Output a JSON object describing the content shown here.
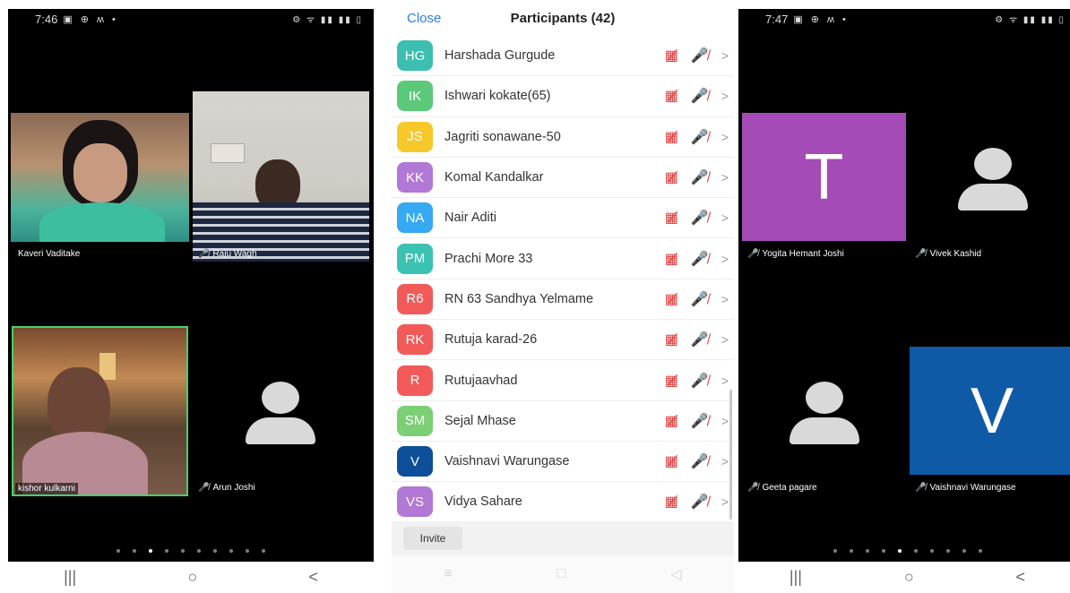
{
  "left_phone": {
    "status_time": "7:46",
    "status_icons": "▣ ⊕ ʍ •",
    "status_right": "⚙ ᯤ ▮▮ ▮▮ ▯",
    "tiles": [
      {
        "name": "Kaveri Vaditake",
        "muted": false
      },
      {
        "name": "Raju Wagh",
        "muted": true
      },
      {
        "name": "kishor kulkarni",
        "muted": false
      },
      {
        "name": "Arun Joshi",
        "muted": true
      }
    ],
    "nav": [
      "|||",
      "○",
      "<"
    ]
  },
  "participants": {
    "close_label": "Close",
    "title": "Participants (42)",
    "rows": [
      {
        "initials": "HG",
        "name": "Harshada Gurgude",
        "color": "#3cbfb0"
      },
      {
        "initials": "IK",
        "name": "Ishwari kokate(65)",
        "color": "#5cc97a"
      },
      {
        "initials": "JS",
        "name": "Jagriti sonawane-50",
        "color": "#f7c82a"
      },
      {
        "initials": "KK",
        "name": "Komal Kandalkar",
        "color": "#b178d6"
      },
      {
        "initials": "NA",
        "name": "Nair Aditi",
        "color": "#35a9f2"
      },
      {
        "initials": "PM",
        "name": "Prachi More 33",
        "color": "#3cc2b3"
      },
      {
        "initials": "R6",
        "name": "RN 63 Sandhya Yelmame",
        "color": "#f25a5a"
      },
      {
        "initials": "RK",
        "name": "Rutuja karad-26",
        "color": "#f25a5a"
      },
      {
        "initials": "R",
        "name": "Rutujaavhad",
        "color": "#f25a5a"
      },
      {
        "initials": "SM",
        "name": "Sejal Mhase",
        "color": "#7ccf74"
      },
      {
        "initials": "V",
        "name": "Vaishnavi Warungase",
        "color": "#0e4f9a"
      },
      {
        "initials": "VS",
        "name": "Vidya Sahare",
        "color": "#b178d6"
      }
    ],
    "invite_label": "Invite",
    "nav": [
      "≡",
      "□",
      "◁"
    ]
  },
  "right_phone": {
    "status_time": "7:47",
    "status_icons": "▣ ⊕ ʍ •",
    "status_right": "⚙ ᯤ ▮▮ ▮▮ ▯",
    "tiles": [
      {
        "letter": "T",
        "name": "Yogita Hemant Joshi",
        "color": "#a44bb8"
      },
      {
        "letter": "",
        "name": "Vivek Kashid",
        "color": "#000000"
      },
      {
        "letter": "",
        "name": "Geeta pagare",
        "color": "#000000"
      },
      {
        "letter": "V",
        "name": "Vaishnavi Warungase",
        "color": "#0f5aa6"
      }
    ],
    "nav": [
      "|||",
      "○",
      "<"
    ]
  }
}
